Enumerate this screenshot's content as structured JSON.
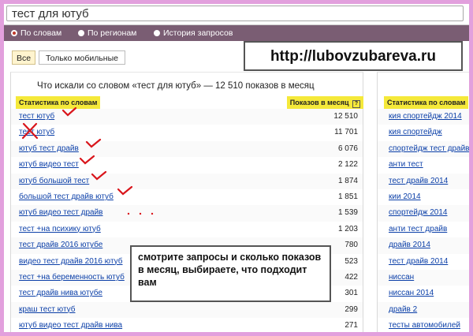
{
  "search": {
    "value": "тест для ютуб"
  },
  "modes": [
    {
      "label": "По словам",
      "selected": true
    },
    {
      "label": "По регионам",
      "selected": false
    },
    {
      "label": "История запросов",
      "selected": false
    }
  ],
  "filters": {
    "all_label": "Все",
    "mobile_label": "Только мобильные"
  },
  "overlay": {
    "url": "http://lubovzubareva.ru",
    "note": "смотрите запросы и сколько показов в месяц, выбираете, что подходит вам"
  },
  "left_panel": {
    "summary": "Что искали со словом «тест для ютуб» — 12 510 показов в месяц",
    "header_words": "Статистика по словам",
    "header_count": "Показов в месяц",
    "help_icon": "?",
    "rows": [
      {
        "keyword": "тест ютуб",
        "count": "12 510"
      },
      {
        "keyword": "тест ютуб",
        "count": "11 701"
      },
      {
        "keyword": "ютуб тест драйв",
        "count": "6 076"
      },
      {
        "keyword": "ютуб видео тест",
        "count": "2 122"
      },
      {
        "keyword": "ютуб большой тест",
        "count": "1 874"
      },
      {
        "keyword": "большой тест драйв ютуб",
        "count": "1 851"
      },
      {
        "keyword": "ютуб видео тест драйв",
        "count": "1 539"
      },
      {
        "keyword": "тест +на психику ютуб",
        "count": "1 203"
      },
      {
        "keyword": "тест драйв 2016 ютубе",
        "count": "780"
      },
      {
        "keyword": "видео тест драйв 2016 ютуб",
        "count": "523"
      },
      {
        "keyword": "тест +на беременность ютуб",
        "count": "422"
      },
      {
        "keyword": "тест драйв нива ютубе",
        "count": "301"
      },
      {
        "keyword": "краш тест ютуб",
        "count": "299"
      },
      {
        "keyword": "ютуб видео тест драйв нива",
        "count": "271"
      }
    ]
  },
  "right_panel": {
    "header_words": "Статистика по словам",
    "rows": [
      "кия спортейдж 2014",
      "кия спортейдж",
      "спортейдж тест драйв",
      "анти тест",
      "тест драйв 2014",
      "кии 2014",
      "спортейдж 2014",
      "анти тест драйв",
      "драйв 2014",
      "тест драйв 2014",
      "ниссан",
      "ниссан 2014",
      "драйв 2",
      "тесты автомобилей"
    ]
  },
  "colors": {
    "frame": "#e2a0dd",
    "mode_bar": "#7a5d73",
    "link": "#0b3fa8",
    "highlight": "#f5e93a",
    "check": "#d9151b"
  },
  "icons": [
    "radio-on-icon",
    "radio-off-icon",
    "help-icon",
    "check-mark-icon",
    "cross-mark-icon"
  ]
}
